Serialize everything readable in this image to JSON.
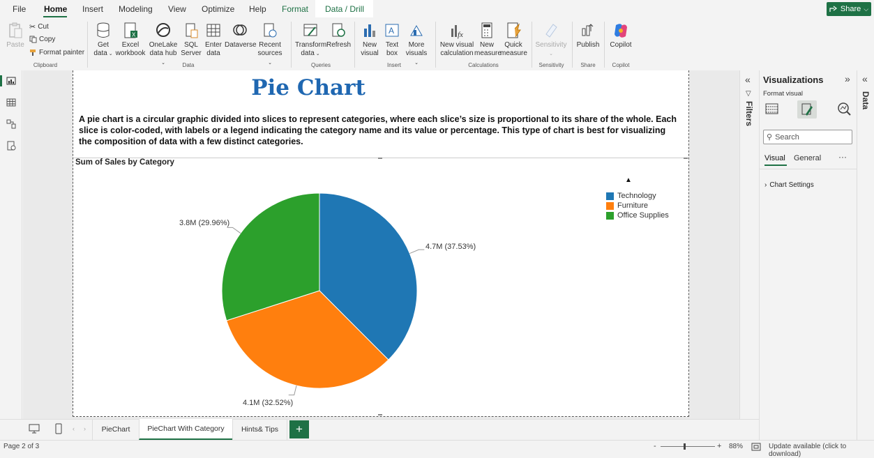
{
  "menu": {
    "file": "File",
    "home": "Home",
    "insert": "Insert",
    "modeling": "Modeling",
    "view": "View",
    "optimize": "Optimize",
    "help": "Help",
    "format": "Format",
    "data_drill": "Data / Drill",
    "share": "Share"
  },
  "ribbon": {
    "paste": "Paste",
    "cut": "Cut",
    "copy": "Copy",
    "format_painter": "Format painter",
    "clipboard": "Clipboard",
    "get_data": [
      "Get",
      "data"
    ],
    "excel": [
      "Excel",
      "workbook"
    ],
    "onelake": [
      "OneLake",
      "data hub"
    ],
    "sql": [
      "SQL",
      "Server"
    ],
    "enter_data": [
      "Enter",
      "data"
    ],
    "dataverse": "Dataverse",
    "recent": [
      "Recent",
      "sources"
    ],
    "data_group": "Data",
    "transform": [
      "Transform",
      "data"
    ],
    "refresh": "Refresh",
    "queries": "Queries",
    "new_visual": [
      "New",
      "visual"
    ],
    "text_box": [
      "Text",
      "box"
    ],
    "more_visuals": [
      "More",
      "visuals"
    ],
    "insert_group": "Insert",
    "new_visual_calc": [
      "New visual",
      "calculation"
    ],
    "new_measure": [
      "New",
      "measure"
    ],
    "quick_measure": [
      "Quick",
      "measure"
    ],
    "calculations": "Calculations",
    "sensitivity": "Sensitivity",
    "sensitivity_group": "Sensitivity",
    "publish": "Publish",
    "share_group": "Share",
    "copilot": "Copilot",
    "copilot_group": "Copilot"
  },
  "report": {
    "title": "Pie Chart",
    "description": "A pie chart is a circular graphic divided into slices to represent categories, where each slice’s size is proportional to its share of the whole. Each slice is color-coded, with labels or a legend indicating the category name and its value or percentage. This type of chart is best for visualizing the composition of data with a few distinct categories."
  },
  "chart_data": {
    "type": "pie",
    "title": "Sum of Sales by Category",
    "categories": [
      "Technology",
      "Furniture",
      "Office Supplies"
    ],
    "values": [
      4.7,
      4.1,
      3.8
    ],
    "percentages": [
      37.53,
      32.52,
      29.96
    ],
    "value_unit": "M",
    "labels": [
      "4.7M (37.53%)",
      "4.1M (32.52%)",
      "3.8M (29.96%)"
    ],
    "colors": [
      "#1f77b4",
      "#ff7f0e",
      "#2ca02c"
    ],
    "legend_placement": "top-right"
  },
  "viz_pane": {
    "title": "Visualizations",
    "format_visual": "Format visual",
    "search_placeholder": "Search",
    "tab_visual": "Visual",
    "tab_general": "General",
    "more": "···",
    "chart_settings": "Chart Settings"
  },
  "filters_label": "Filters",
  "data_label": "Data",
  "tabs": [
    "PieChart",
    "PieChart With Category",
    "Hints& Tips"
  ],
  "add_tab": "+",
  "status": {
    "page": "Page 2 of 3",
    "zoom": "88%",
    "update": "Update available (click to download)"
  },
  "accent": "#1e7145"
}
